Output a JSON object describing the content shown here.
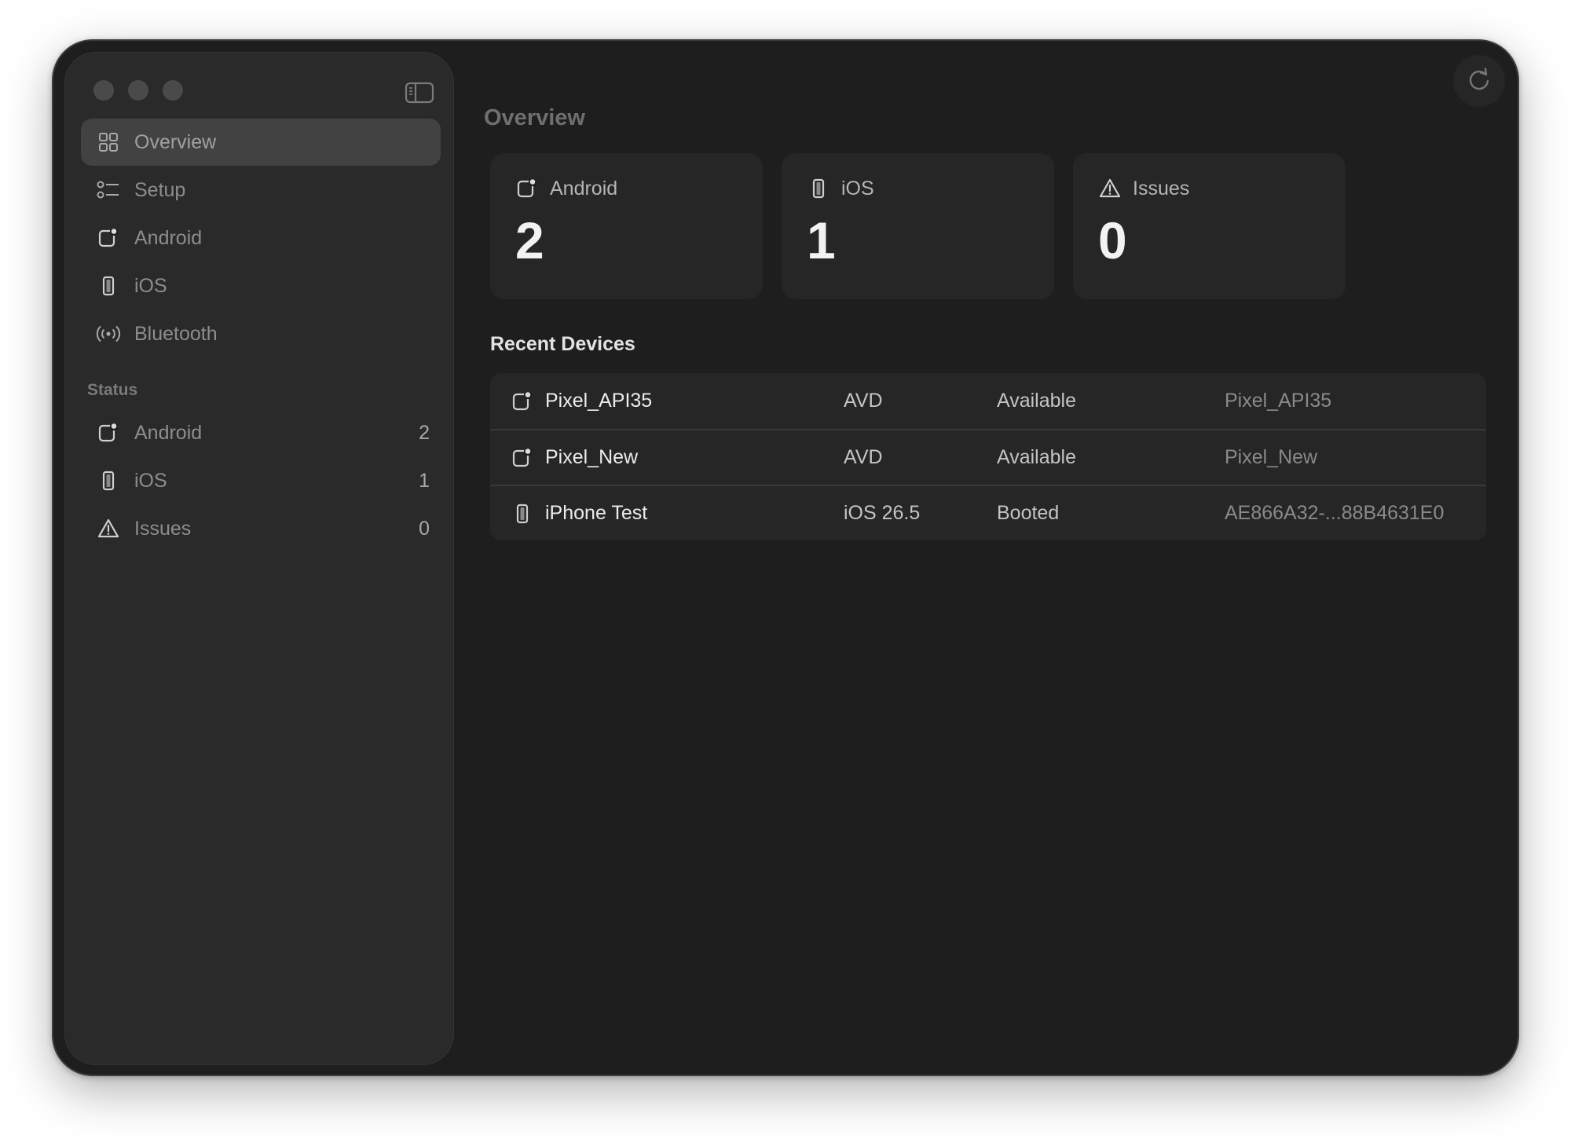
{
  "window": {
    "title": "Overview"
  },
  "sidebar": {
    "items": [
      {
        "label": "Overview",
        "icon": "grid-icon",
        "active": true
      },
      {
        "label": "Setup",
        "icon": "checklist-icon"
      },
      {
        "label": "Android",
        "icon": "android-device-icon"
      },
      {
        "label": "iOS",
        "icon": "iphone-icon"
      },
      {
        "label": "Bluetooth",
        "icon": "bluetooth-broadcast-icon"
      }
    ],
    "status_section": {
      "label": "Status",
      "items": [
        {
          "label": "Android",
          "icon": "android-device-icon",
          "count": "2"
        },
        {
          "label": "iOS",
          "icon": "iphone-icon",
          "count": "1"
        },
        {
          "label": "Issues",
          "icon": "warning-icon",
          "count": "0"
        }
      ]
    }
  },
  "cards": [
    {
      "label": "Android",
      "icon": "android-device-icon",
      "value": "2"
    },
    {
      "label": "iOS",
      "icon": "iphone-icon",
      "value": "1"
    },
    {
      "label": "Issues",
      "icon": "warning-icon",
      "value": "0"
    }
  ],
  "recent_devices": {
    "title": "Recent Devices",
    "rows": [
      {
        "name": "Pixel_API35",
        "type": "AVD",
        "status": "Available",
        "id": "Pixel_API35",
        "icon": "android-device-icon"
      },
      {
        "name": "Pixel_New",
        "type": "AVD",
        "status": "Available",
        "id": "Pixel_New",
        "icon": "android-device-icon"
      },
      {
        "name": "iPhone Test",
        "type": "iOS 26.5",
        "status": "Booted",
        "id": "AE866A32-...88B4631E0",
        "icon": "iphone-icon"
      }
    ]
  },
  "toolbar": {
    "refresh_icon": "refresh-icon"
  },
  "colors": {
    "window_bg": "#1e1e1e",
    "sidebar_bg": "#2a2a2a",
    "active_item_bg": "#424242",
    "card_bg": "#262626"
  }
}
